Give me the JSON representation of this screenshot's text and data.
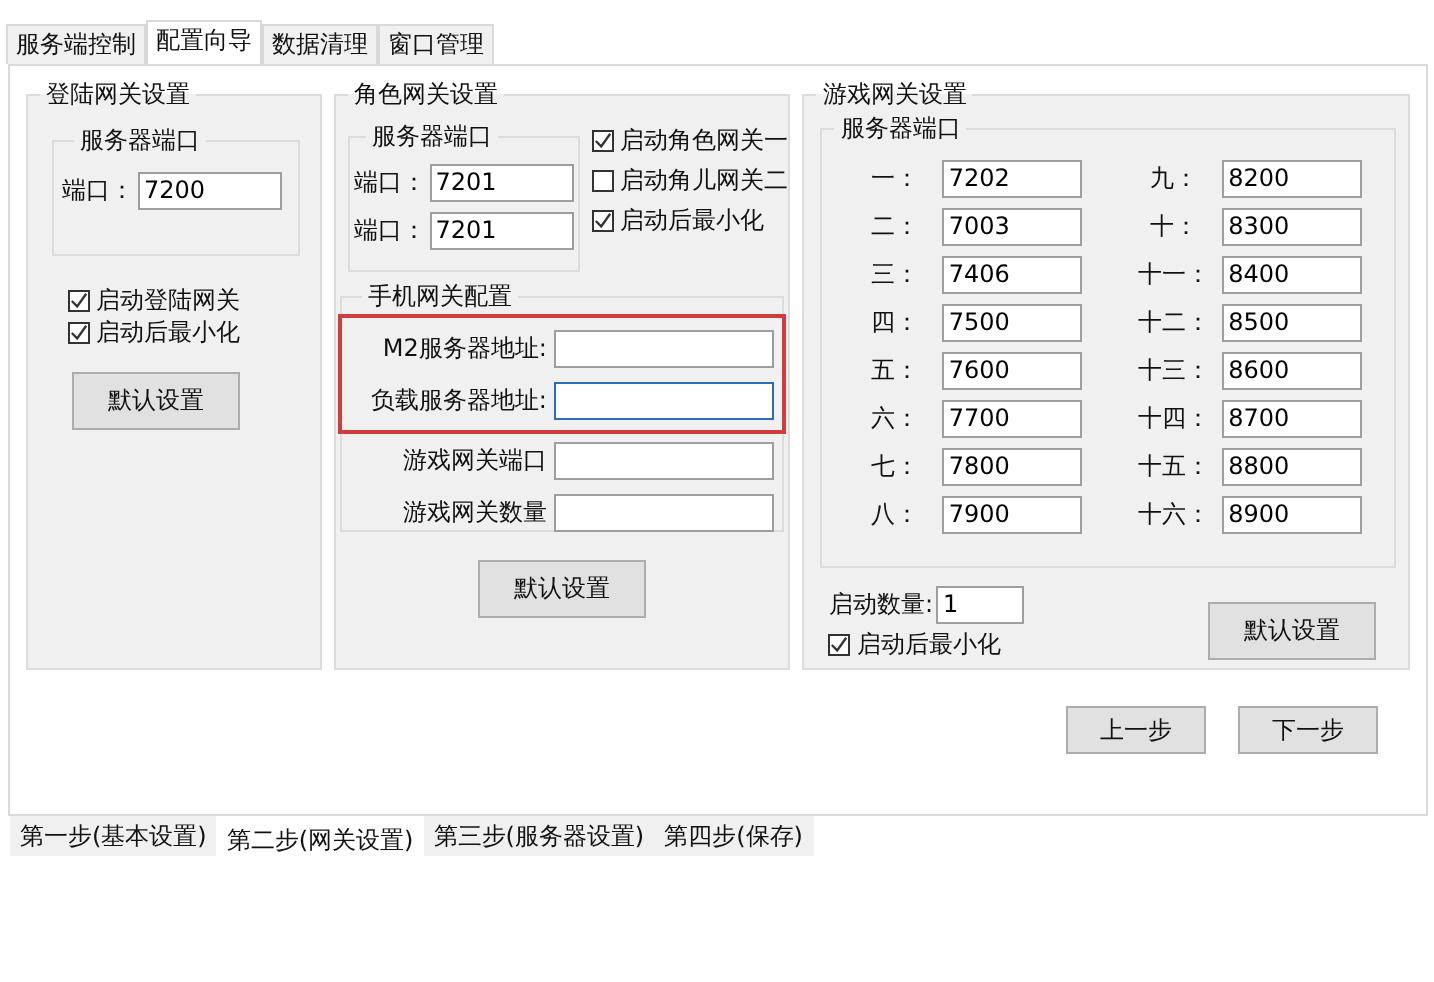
{
  "top_tabs": [
    {
      "label": "服务端控制",
      "selected": false
    },
    {
      "label": "配置向导",
      "selected": true
    },
    {
      "label": "数据清理",
      "selected": false
    },
    {
      "label": "窗口管理",
      "selected": false
    }
  ],
  "login_gateway": {
    "title": "登陆网关设置",
    "port_group": {
      "title": "服务器端口",
      "fields": [
        {
          "label": "端口：",
          "value": "7200"
        }
      ]
    },
    "checkboxes": [
      {
        "label": "启动登陆网关",
        "checked": true
      },
      {
        "label": "启动后最小化",
        "checked": true
      }
    ],
    "button": "默认设置"
  },
  "role_gateway": {
    "title": "角色网关设置",
    "port_group": {
      "title": "服务器端口",
      "fields": [
        {
          "label": "端口：",
          "value": "7201"
        },
        {
          "label": "端口：",
          "value": "7201"
        }
      ]
    },
    "checkboxes": [
      {
        "label": "启动角色网关一",
        "checked": true
      },
      {
        "label": "启动角儿网关二",
        "checked": false
      },
      {
        "label": "启动后最小化",
        "checked": true
      }
    ],
    "mobile": {
      "title": "手机网关配置",
      "fields": [
        {
          "label": "M2服务器地址:",
          "highlighted": true,
          "focused": false
        },
        {
          "label": "负载服务器地址:",
          "highlighted": true,
          "focused": true
        },
        {
          "label": "游戏网关端口",
          "highlighted": false,
          "focused": false
        },
        {
          "label": "游戏网关数量",
          "highlighted": false,
          "focused": false
        }
      ]
    },
    "button": "默认设置"
  },
  "game_gateway": {
    "title": "游戏网关设置",
    "port_group": {
      "title": "服务器端口",
      "columns": [
        [
          {
            "label": "一：",
            "value": "7202"
          },
          {
            "label": "二：",
            "value": "7003"
          },
          {
            "label": "三：",
            "value": "7406"
          },
          {
            "label": "四：",
            "value": "7500"
          },
          {
            "label": "五：",
            "value": "7600"
          },
          {
            "label": "六：",
            "value": "7700"
          },
          {
            "label": "七：",
            "value": "7800"
          },
          {
            "label": "八：",
            "value": "7900"
          }
        ],
        [
          {
            "label": "九：",
            "value": "8200"
          },
          {
            "label": "十：",
            "value": "8300"
          },
          {
            "label": "十一：",
            "value": "8400"
          },
          {
            "label": "十二：",
            "value": "8500"
          },
          {
            "label": "十三：",
            "value": "8600"
          },
          {
            "label": "十四：",
            "value": "8700"
          },
          {
            "label": "十五：",
            "value": "8800"
          },
          {
            "label": "十六：",
            "value": "8900"
          }
        ]
      ]
    },
    "count": {
      "label": "启动数量:",
      "value": "1"
    },
    "checkboxes": [
      {
        "label": "启动后最小化",
        "checked": true
      }
    ],
    "button": "默认设置"
  },
  "nav_buttons": [
    "上一步",
    "下一步"
  ],
  "step_tabs": [
    {
      "label": "第一步(基本设置)",
      "selected": false
    },
    {
      "label": "第二步(网关设置)",
      "selected": true
    },
    {
      "label": "第三步(服务器设置)",
      "selected": false
    },
    {
      "label": "第四步(保存)",
      "selected": false
    }
  ]
}
